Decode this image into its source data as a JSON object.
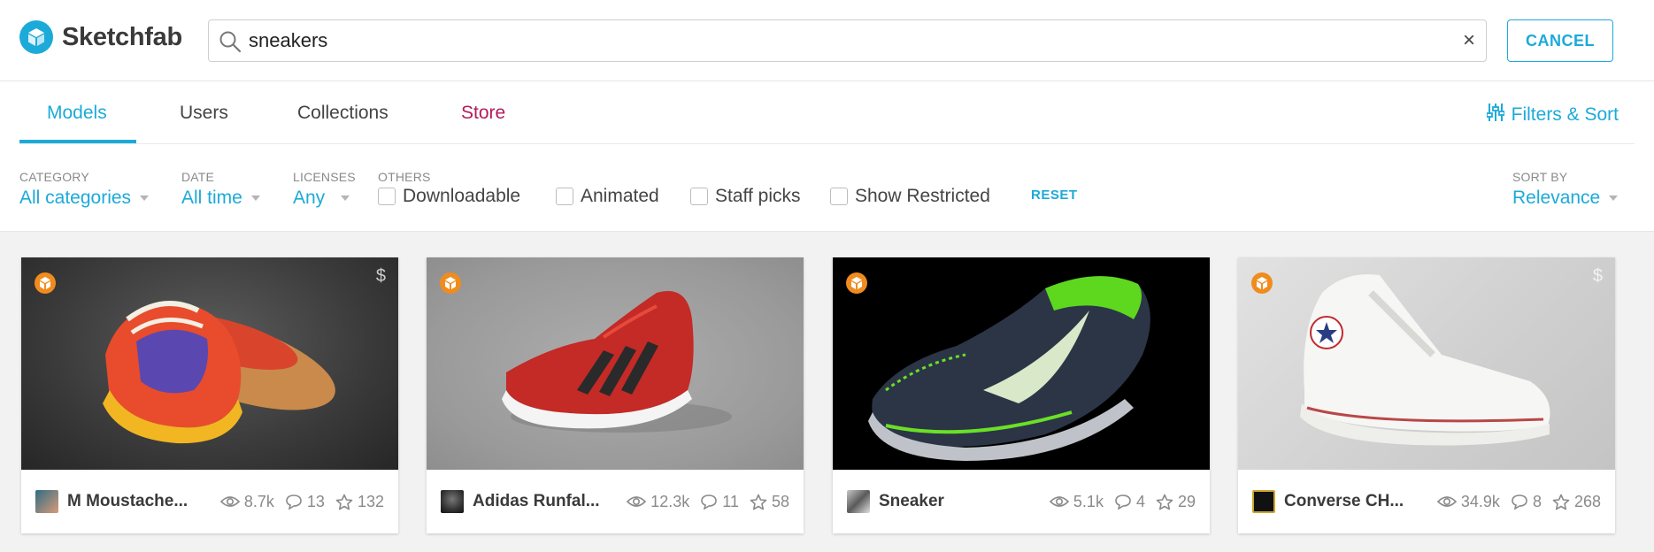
{
  "header": {
    "brand": "Sketchfab",
    "search_value": "sneakers",
    "clear_label": "×",
    "cancel_label": "CANCEL"
  },
  "tabs": [
    {
      "label": "Models",
      "active": true
    },
    {
      "label": "Users",
      "active": false
    },
    {
      "label": "Collections",
      "active": false
    },
    {
      "label": "Store",
      "active": false
    }
  ],
  "filters_sort_label": "Filters & Sort",
  "filters": {
    "category": {
      "label": "CATEGORY",
      "value": "All categories"
    },
    "date": {
      "label": "DATE",
      "value": "All time"
    },
    "licenses": {
      "label": "LICENSES",
      "value": "Any"
    },
    "others": {
      "label": "OTHERS",
      "options": [
        {
          "label": "Downloadable",
          "checked": false
        },
        {
          "label": "Animated",
          "checked": false
        },
        {
          "label": "Staff picks",
          "checked": false
        },
        {
          "label": "Show Restricted",
          "checked": false
        }
      ]
    },
    "reset_label": "RESET",
    "sort": {
      "label": "SORT BY",
      "value": "Relevance"
    }
  },
  "models": [
    {
      "name": "M Moustache...",
      "views": "8.7k",
      "comments": "13",
      "likes": "132",
      "has_price": true
    },
    {
      "name": "Adidas Runfal...",
      "views": "12.3k",
      "comments": "11",
      "likes": "58",
      "has_price": false
    },
    {
      "name": "Sneaker",
      "views": "5.1k",
      "comments": "4",
      "likes": "29",
      "has_price": false
    },
    {
      "name": "Converse CH...",
      "views": "34.9k",
      "comments": "8",
      "likes": "268",
      "has_price": true
    }
  ],
  "price_symbol": "$",
  "colors": {
    "accent": "#1caad9",
    "store": "#b51a5a",
    "badge": "#f08c1e"
  }
}
